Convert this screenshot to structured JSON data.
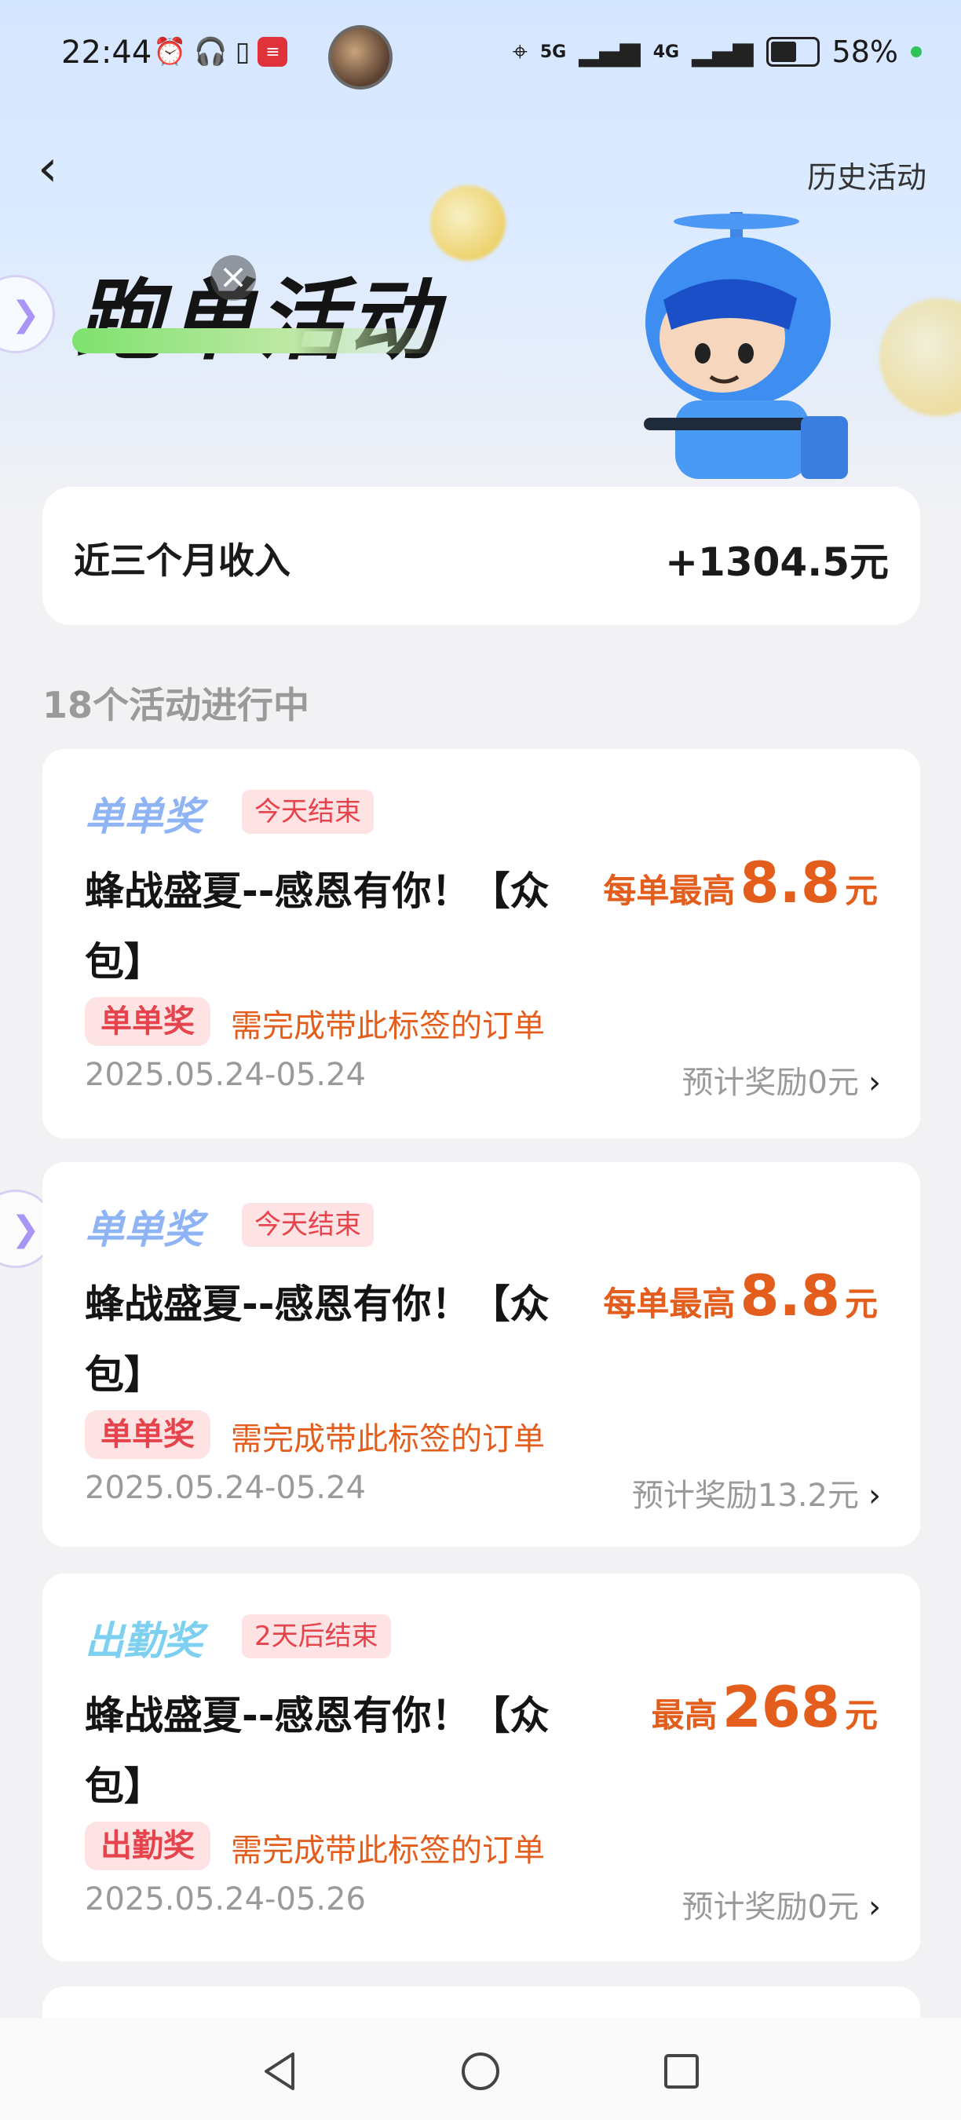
{
  "status_bar": {
    "time": "22:44",
    "network_5g": "5G",
    "network_4g": "4G",
    "battery": "58%"
  },
  "header": {
    "back_icon": "chevron-left-icon",
    "history_label": "历史活动",
    "title": "跑单活动"
  },
  "income": {
    "label": "近三个月收入",
    "value": "+1304.5元"
  },
  "section": {
    "title": "18个活动进行中"
  },
  "activities": [
    {
      "type": "单单奖",
      "type_color": "#8fb4f5",
      "status": "今天结束",
      "title": "蜂战盛夏--感恩有你！【众包】",
      "reward_prefix": "每单最高",
      "reward_value": "8.8",
      "reward_unit": "元",
      "chip": "单单奖",
      "chip_desc": "需完成带此标签的订单",
      "date": "2025.05.24-05.24",
      "estimate": "预计奖励0元"
    },
    {
      "type": "单单奖",
      "type_color": "#8fb4f5",
      "status": "今天结束",
      "title": "蜂战盛夏--感恩有你！【众包】",
      "reward_prefix": "每单最高",
      "reward_value": "8.8",
      "reward_unit": "元",
      "chip": "单单奖",
      "chip_desc": "需完成带此标签的订单",
      "date": "2025.05.24-05.24",
      "estimate": "预计奖励13.2元"
    },
    {
      "type": "出勤奖",
      "type_color": "#7dd0ef",
      "status": "2天后结束",
      "title": "蜂战盛夏--感恩有你！【众包】",
      "reward_prefix": "最高",
      "reward_value": "268",
      "reward_unit": "元",
      "chip": "出勤奖",
      "chip_desc": "需完成带此标签的订单",
      "date": "2025.05.24-05.26",
      "estimate": "预计奖励0元"
    }
  ],
  "colors": {
    "accent_orange": "#e35e1d",
    "tag_red": "#e6434d",
    "tag_bg": "#fde3e4"
  }
}
